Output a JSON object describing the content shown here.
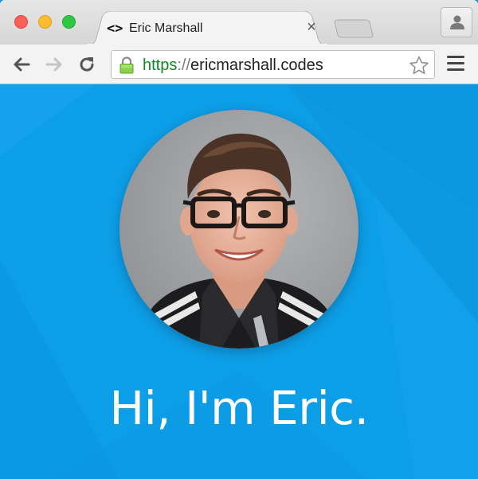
{
  "browser": {
    "tab": {
      "favicon": "<>",
      "title": "Eric Marshall",
      "close": "×"
    },
    "address": {
      "scheme": "https",
      "separator": "://",
      "host": "ericmarshall.codes",
      "secure": true
    },
    "icons": {
      "back": "back-arrow-icon",
      "forward": "forward-arrow-icon",
      "reload": "reload-icon",
      "lock": "lock-icon",
      "bookmark": "star-icon",
      "menu": "hamburger-menu-icon",
      "profile": "profile-icon"
    }
  },
  "page": {
    "avatar_alt": "avatar",
    "greeting": "Hi, I'm Eric.",
    "colors": {
      "background": "#0d9ee8",
      "text": "#ffffff",
      "secure_scheme": "#0b8a1f"
    }
  }
}
